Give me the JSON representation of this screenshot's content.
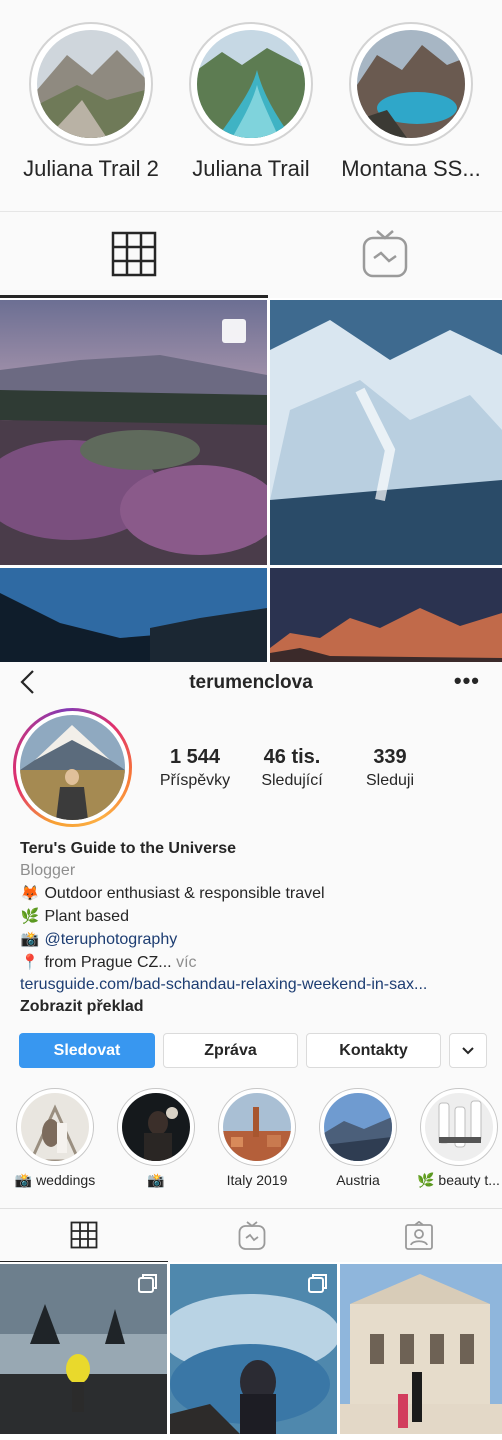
{
  "top_highlights": [
    {
      "label": "Juliana Trail 2"
    },
    {
      "label": "Juliana Trail"
    },
    {
      "label": "Montana SS..."
    }
  ],
  "top_tabs": [
    {
      "icon": "grid-icon",
      "active": true
    },
    {
      "icon": "igtv-icon",
      "active": false
    }
  ],
  "profile": {
    "username": "terumenclova",
    "more_label": "•••",
    "stats": [
      {
        "value": "1 544",
        "label": "Příspěvky"
      },
      {
        "value": "46 tis.",
        "label": "Sledující"
      },
      {
        "value": "339",
        "label": "Sleduji"
      }
    ],
    "bio": {
      "name": "Teru's Guide to the Universe",
      "category": "Blogger",
      "line1_emoji": "🦊",
      "line1": "Outdoor enthusiast & responsible travel",
      "line2_emoji": "🌿",
      "line2": "Plant based",
      "line3_emoji": "📸",
      "line3": "@teruphotography",
      "line4_emoji": "📍",
      "line4": "from Prague CZ...",
      "more": "víc",
      "link": "terusguide.com/bad-schandau-relaxing-weekend-in-sax...",
      "translate": "Zobrazit překlad"
    },
    "buttons": {
      "follow": "Sledovat",
      "message": "Zpráva",
      "contacts": "Kontakty"
    },
    "highlights": [
      {
        "label": "📸 weddings"
      },
      {
        "label": "📸"
      },
      {
        "label": "Italy 2019"
      },
      {
        "label": "Austria"
      },
      {
        "label": "🌿 beauty t..."
      }
    ]
  }
}
